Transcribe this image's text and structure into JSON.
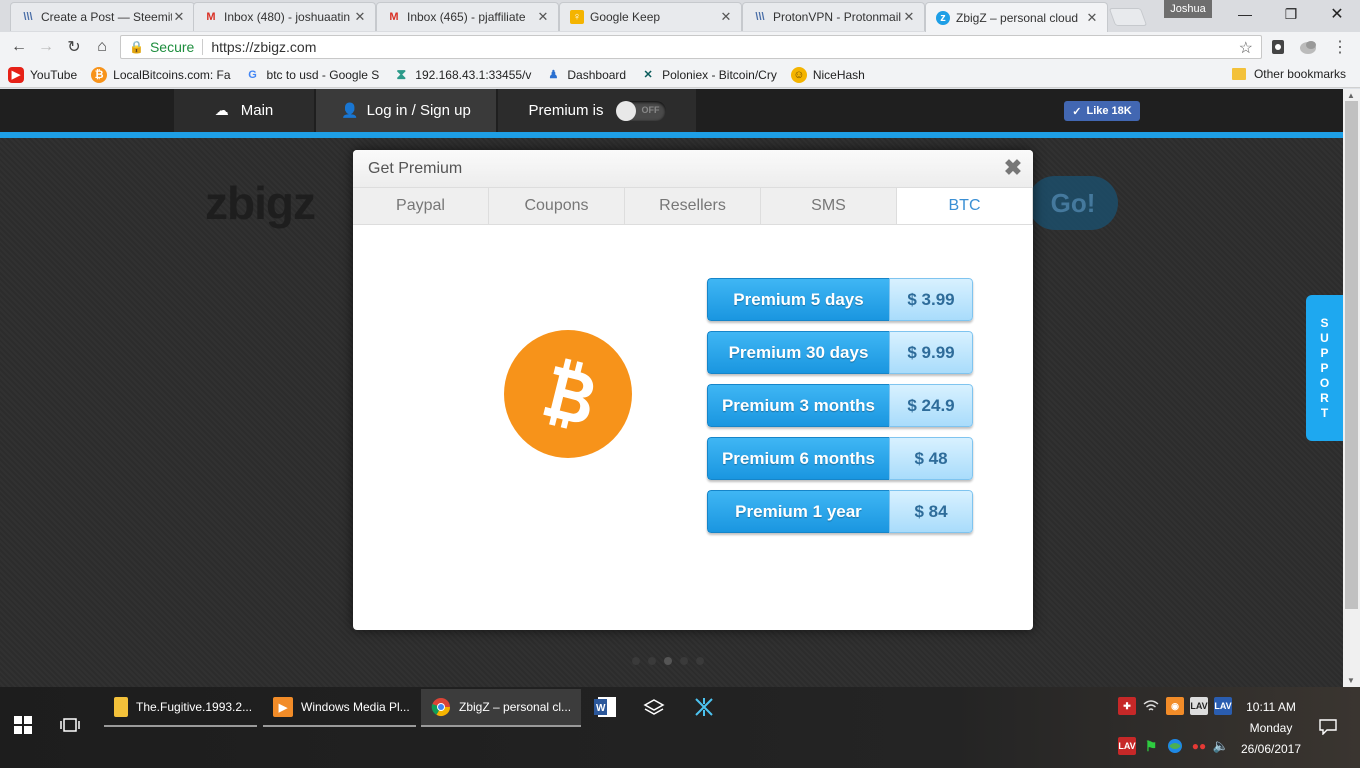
{
  "browser": {
    "tabs": [
      {
        "title": "Create a Post — Steemit",
        "icon": "steemit-icon"
      },
      {
        "title": "Inbox (480) - joshuaatin",
        "icon": "gmail-icon"
      },
      {
        "title": "Inbox (465) - pjaffiliate",
        "icon": "gmail-icon"
      },
      {
        "title": "Google Keep",
        "icon": "keep-icon"
      },
      {
        "title": "ProtonVPN - Protonmail",
        "icon": "steemit-icon"
      },
      {
        "title": "ZbigZ – personal cloud",
        "icon": "zbigz-icon"
      }
    ],
    "profile_name": "Joshua",
    "secure_label": "Secure",
    "url": "https://zbigz.com",
    "bookmarks": [
      {
        "label": "YouTube",
        "icon": "youtube-icon"
      },
      {
        "label": "LocalBitcoins.com: Fa",
        "icon": "bitcoin-icon"
      },
      {
        "label": "btc to usd - Google S",
        "icon": "google-icon"
      },
      {
        "label": "192.168.43.1:33455/v",
        "icon": "hourglass-icon"
      },
      {
        "label": "Dashboard",
        "icon": "dashboard-icon"
      },
      {
        "label": "Poloniex - Bitcoin/Cry",
        "icon": "poloniex-icon"
      },
      {
        "label": "NiceHash",
        "icon": "nicehash-icon"
      }
    ],
    "other_bookmarks": "Other bookmarks"
  },
  "site": {
    "nav": {
      "main": "Main",
      "login": "Log in / Sign up",
      "premium": "Premium is",
      "toggle_state": "OFF",
      "fb_like": "Like 18K"
    },
    "logo": "zbigz",
    "go": "Go!",
    "support": "SUPPORT"
  },
  "modal": {
    "title": "Get Premium",
    "tabs": [
      "Paypal",
      "Coupons",
      "Resellers",
      "SMS",
      "BTC"
    ],
    "active_tab": "BTC",
    "plans": [
      {
        "name": "Premium 5 days",
        "price": "$ 3.99"
      },
      {
        "name": "Premium 30 days",
        "price": "$ 9.99"
      },
      {
        "name": "Premium 3 months",
        "price": "$ 24.9"
      },
      {
        "name": "Premium 6 months",
        "price": "$ 48"
      },
      {
        "name": "Premium 1 year",
        "price": "$ 84"
      }
    ],
    "colors": {
      "bitcoin": "#f7931a",
      "plan_button": "#1ea8f0",
      "active_tab_text": "#3a8fd4"
    }
  },
  "taskbar": {
    "apps": [
      {
        "label": "The.Fugitive.1993.2...",
        "icon": "folder-icon"
      },
      {
        "label": "Windows Media Pl...",
        "icon": "media-player-icon"
      },
      {
        "label": "ZbigZ – personal cl...",
        "icon": "chrome-icon"
      }
    ],
    "time": "10:11 AM",
    "day": "Monday",
    "date": "26/06/2017"
  }
}
